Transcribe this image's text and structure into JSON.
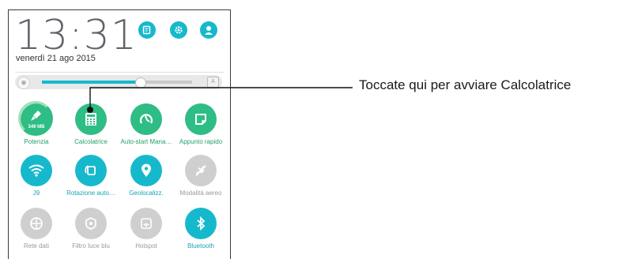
{
  "clock": {
    "time": "13:31",
    "date": "venerdì 21 ago 2015"
  },
  "top_icons": [
    {
      "name": "notes-icon"
    },
    {
      "name": "settings-icon"
    },
    {
      "name": "user-avatar-icon"
    }
  ],
  "brightness": {
    "level_percent": 65
  },
  "tiles": [
    {
      "id": "potenzia",
      "label": "Potenzia",
      "state": "green",
      "badge": "349 MB",
      "icon": "broom-icon"
    },
    {
      "id": "calcolatrice",
      "label": "Calcolatrice",
      "state": "green",
      "icon": "calculator-icon"
    },
    {
      "id": "autostart",
      "label": "Auto-start Mana…",
      "state": "green",
      "icon": "auto-start-icon"
    },
    {
      "id": "appunto",
      "label": "Appunto rapido",
      "state": "green",
      "icon": "quick-memo-icon"
    },
    {
      "id": "wifi",
      "label": "J9",
      "state": "on",
      "icon": "wifi-icon"
    },
    {
      "id": "rotazione",
      "label": "Rotazione auto…",
      "state": "on",
      "icon": "rotation-icon"
    },
    {
      "id": "geoloc",
      "label": "Geolocalizz.",
      "state": "on",
      "icon": "location-icon"
    },
    {
      "id": "aereo",
      "label": "Modalità aereo",
      "state": "off",
      "icon": "airplane-icon"
    },
    {
      "id": "rete",
      "label": "Rete dati",
      "state": "off",
      "icon": "mobile-data-icon"
    },
    {
      "id": "filtro",
      "label": "Filtro luce blu",
      "state": "off",
      "icon": "blue-light-filter-icon"
    },
    {
      "id": "hotspot",
      "label": "Hotspot",
      "state": "off",
      "icon": "hotspot-icon"
    },
    {
      "id": "bluetooth",
      "label": "Bluetooth",
      "state": "on",
      "icon": "bluetooth-icon"
    }
  ],
  "callout": {
    "text": "Toccate qui per avviare Calcolatrice"
  },
  "colors": {
    "accent": "#16b9cc",
    "green": "#2ebd84",
    "off": "#cfcfcf"
  }
}
